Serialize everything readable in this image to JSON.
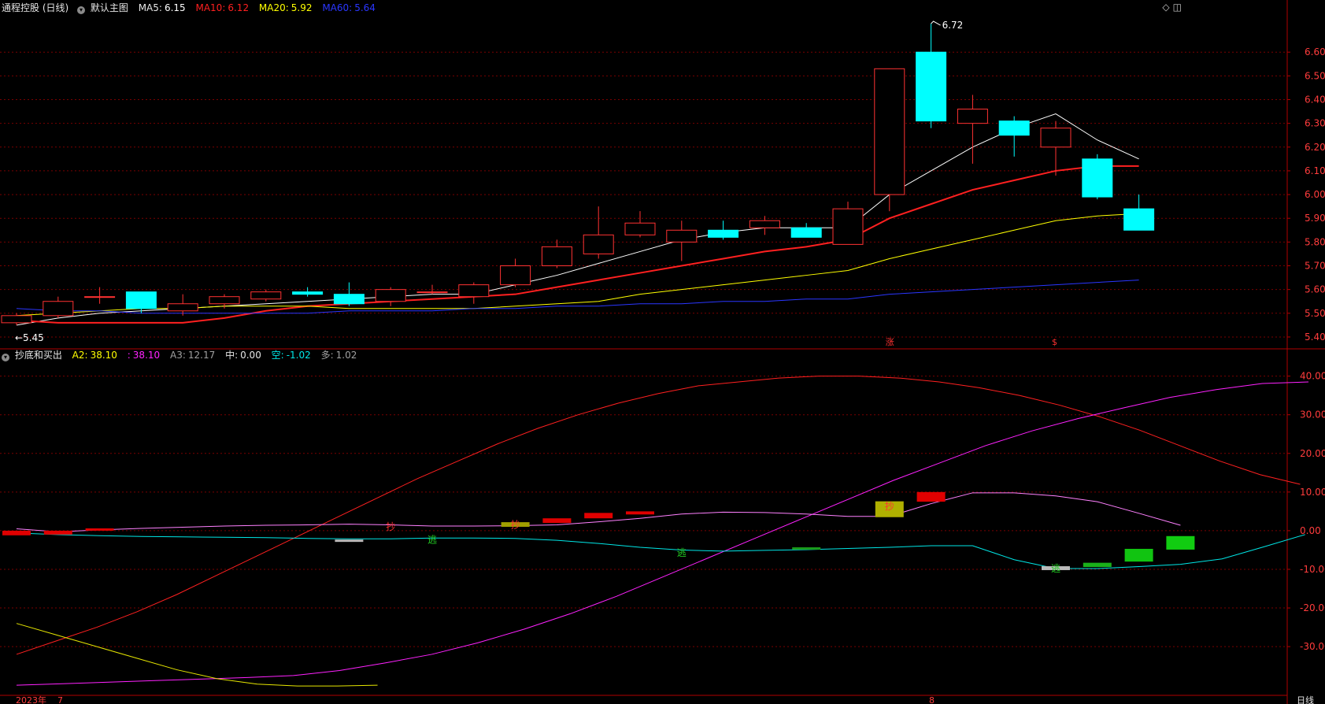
{
  "header": {
    "title": "通程控股 (日线)",
    "template_label": "默认主图",
    "ma5_label": "MA5:",
    "ma5_value": "6.15",
    "ma5_color": "#ffffff",
    "ma10_label": "MA10:",
    "ma10_value": "6.12",
    "ma10_color": "#ff2020",
    "ma20_label": "MA20:",
    "ma20_value": "5.92",
    "ma20_color": "#ffff00",
    "ma60_label": "MA60:",
    "ma60_value": "5.64",
    "ma60_color": "#2a36ff"
  },
  "indicator_header": {
    "name": "抄底和买出",
    "a2_label": "A2:",
    "a2_value": "38.10",
    "a2b_label": ":",
    "a2b_value": "38.10",
    "a3_label": "A3:",
    "a3_value": "12.17",
    "zhong_label": "中:",
    "zhong_value": "0.00",
    "kong_label": "空:",
    "kong_value": "-1.02",
    "duo_label": "多:",
    "duo_value": "1.02"
  },
  "colors": {
    "up": "#ff3232",
    "down": "#00ffff",
    "axis": "#b00000",
    "grid": "#7a0000",
    "axis_label": "#ff3c3c"
  },
  "chart_data": [
    {
      "type": "candlestick",
      "name": "price",
      "ylim": [
        5.36,
        6.74
      ],
      "y_ticks": [
        "5.40",
        "5.50",
        "5.60",
        "5.70",
        "5.80",
        "5.90",
        "6.00",
        "6.10",
        "6.20",
        "6.30",
        "6.40",
        "6.50",
        "6.60"
      ],
      "candles": [
        {
          "o": 5.46,
          "h": 5.5,
          "l": 5.45,
          "c": 5.49
        },
        {
          "o": 5.49,
          "h": 5.57,
          "l": 5.48,
          "c": 5.55
        },
        {
          "o": 5.57,
          "h": 5.61,
          "l": 5.54,
          "c": 5.57
        },
        {
          "o": 5.59,
          "h": 5.59,
          "l": 5.5,
          "c": 5.52
        },
        {
          "o": 5.51,
          "h": 5.58,
          "l": 5.49,
          "c": 5.54
        },
        {
          "o": 5.54,
          "h": 5.58,
          "l": 5.52,
          "c": 5.57
        },
        {
          "o": 5.56,
          "h": 5.6,
          "l": 5.55,
          "c": 5.59
        },
        {
          "o": 5.59,
          "h": 5.61,
          "l": 5.57,
          "c": 5.58
        },
        {
          "o": 5.58,
          "h": 5.63,
          "l": 5.53,
          "c": 5.54
        },
        {
          "o": 5.55,
          "h": 5.61,
          "l": 5.53,
          "c": 5.6
        },
        {
          "o": 5.59,
          "h": 5.62,
          "l": 5.58,
          "c": 5.59
        },
        {
          "o": 5.57,
          "h": 5.63,
          "l": 5.54,
          "c": 5.62
        },
        {
          "o": 5.62,
          "h": 5.73,
          "l": 5.61,
          "c": 5.7
        },
        {
          "o": 5.7,
          "h": 5.81,
          "l": 5.69,
          "c": 5.78
        },
        {
          "o": 5.75,
          "h": 5.95,
          "l": 5.73,
          "c": 5.83
        },
        {
          "o": 5.83,
          "h": 5.93,
          "l": 5.82,
          "c": 5.88
        },
        {
          "o": 5.8,
          "h": 5.89,
          "l": 5.72,
          "c": 5.85
        },
        {
          "o": 5.85,
          "h": 5.89,
          "l": 5.81,
          "c": 5.82
        },
        {
          "o": 5.86,
          "h": 5.91,
          "l": 5.83,
          "c": 5.89
        },
        {
          "o": 5.86,
          "h": 5.88,
          "l": 5.82,
          "c": 5.82
        },
        {
          "o": 5.79,
          "h": 5.97,
          "l": 5.79,
          "c": 5.94
        },
        {
          "o": 6.0,
          "h": 6.53,
          "l": 5.93,
          "c": 6.53
        },
        {
          "o": 6.6,
          "h": 6.72,
          "l": 6.28,
          "c": 6.31
        },
        {
          "o": 6.3,
          "h": 6.42,
          "l": 6.13,
          "c": 6.36
        },
        {
          "o": 6.31,
          "h": 6.33,
          "l": 6.16,
          "c": 6.25
        },
        {
          "o": 6.2,
          "h": 6.31,
          "l": 6.08,
          "c": 6.28
        },
        {
          "o": 6.15,
          "h": 6.17,
          "l": 5.98,
          "c": 5.99
        },
        {
          "o": 5.94,
          "h": 6.0,
          "l": 5.85,
          "c": 5.85
        }
      ],
      "series": [
        {
          "name": "MA5",
          "color": "#ffffff",
          "values": [
            5.45,
            5.48,
            5.5,
            5.51,
            5.52,
            5.53,
            5.54,
            5.55,
            5.56,
            5.57,
            5.58,
            5.58,
            5.62,
            5.66,
            5.71,
            5.76,
            5.81,
            5.84,
            5.86,
            5.86,
            5.86,
            6.0,
            6.1,
            6.2,
            6.28,
            6.34,
            6.23,
            6.15
          ]
        },
        {
          "name": "MA10",
          "color": "#ff2020",
          "values": [
            5.47,
            5.46,
            5.46,
            5.46,
            5.46,
            5.48,
            5.51,
            5.53,
            5.54,
            5.55,
            5.56,
            5.57,
            5.58,
            5.61,
            5.64,
            5.67,
            5.7,
            5.73,
            5.76,
            5.78,
            5.81,
            5.9,
            5.96,
            6.02,
            6.06,
            6.1,
            6.12,
            6.12
          ]
        },
        {
          "name": "MA20",
          "color": "#ffff00",
          "values": [
            5.49,
            5.5,
            5.51,
            5.52,
            5.52,
            5.53,
            5.53,
            5.53,
            5.52,
            5.52,
            5.52,
            5.52,
            5.53,
            5.54,
            5.55,
            5.58,
            5.6,
            5.62,
            5.64,
            5.66,
            5.68,
            5.73,
            5.77,
            5.81,
            5.85,
            5.89,
            5.91,
            5.92
          ]
        },
        {
          "name": "MA60",
          "color": "#2a36ff",
          "values": [
            5.52,
            5.51,
            5.51,
            5.5,
            5.5,
            5.5,
            5.5,
            5.5,
            5.51,
            5.51,
            5.51,
            5.52,
            5.52,
            5.53,
            5.53,
            5.54,
            5.54,
            5.55,
            5.55,
            5.56,
            5.56,
            5.58,
            5.59,
            5.6,
            5.61,
            5.62,
            5.63,
            5.64
          ]
        }
      ],
      "annotations": {
        "high_label": "6.72",
        "low_label": "5.45"
      },
      "markers": [
        {
          "text": "涨",
          "index": 21
        },
        {
          "text": "$",
          "index": 25
        }
      ]
    },
    {
      "type": "line",
      "name": "抄底和买出",
      "ylim": [
        -42,
        44
      ],
      "y_ticks": [
        "40.00",
        "30.00",
        "20.00",
        "10.00",
        "0.00",
        "-10.00",
        "-20.00",
        "-30.00"
      ],
      "y_tick_values": [
        40,
        30,
        20,
        10,
        0,
        -10,
        -20,
        -30
      ],
      "series": [
        {
          "name": "A2",
          "color": "#ff2020",
          "values": [
            -32,
            -28.5,
            -25,
            -21,
            -16.5,
            -11.5,
            -6.5,
            -1.5,
            3.5,
            8.5,
            13.5,
            18,
            22.5,
            26.5,
            30,
            33,
            35.5,
            37.5,
            38.5,
            39.5,
            40,
            40,
            39.5,
            38.5,
            37,
            35,
            32.5,
            29.5,
            26,
            22,
            18,
            14.5,
            12
          ]
        },
        {
          "name": "A2b",
          "color": "#ff22ff",
          "values": [
            -40,
            -39.6,
            -39.2,
            -38.8,
            -38.4,
            -38,
            -37.5,
            -36.2,
            -34.2,
            -32,
            -29,
            -25.5,
            -21.5,
            -17,
            -12,
            -7,
            -2,
            3,
            8,
            13,
            17.5,
            22,
            25.8,
            29,
            31.8,
            34.5,
            36.5,
            38.1,
            38.5
          ]
        },
        {
          "name": "A3",
          "color": "#e6e600",
          "values": [
            -24,
            -27,
            -30,
            -33,
            -36,
            -38.3,
            -39.7,
            -40.2,
            -40.2,
            -40
          ]
        },
        {
          "name": "中",
          "color": "#ff80ff",
          "values": [
            0.5,
            -0.3,
            0.2,
            0.6,
            0.9,
            1.2,
            1.4,
            1.5,
            1.7,
            1.5,
            1.2,
            1.2,
            1.3,
            1.5,
            2.3,
            3.2,
            4.3,
            4.8,
            4.7,
            4.3,
            3.7,
            3.7,
            7,
            9.8,
            9.8,
            9,
            7.5,
            4.5,
            1.4
          ]
        },
        {
          "name": "空",
          "color": "#00e6e6",
          "values": [
            -0.6,
            -1.0,
            -1.3,
            -1.5,
            -1.6,
            -1.7,
            -1.8,
            -2.0,
            -2.1,
            -2.1,
            -1.9,
            -1.9,
            -2.0,
            -2.5,
            -3.3,
            -4.3,
            -5.0,
            -5.3,
            -5.1,
            -4.9,
            -4.6,
            -4.3,
            -3.9,
            -3.9,
            -7.5,
            -9.8,
            -9.8,
            -9.3,
            -8.7,
            -7.3,
            -4.2,
            -1.0
          ]
        }
      ],
      "bars": [
        {
          "index": 0,
          "from": 0,
          "to": -1.2,
          "color": "#e00000"
        },
        {
          "index": 1,
          "from": 0,
          "to": -1.0,
          "color": "#e00000"
        },
        {
          "index": 2,
          "from": 0,
          "to": 0.6,
          "color": "#e00000"
        },
        {
          "index": 8,
          "from": -2.3,
          "to": -2.9,
          "color": "#bbbbbb"
        },
        {
          "index": 12,
          "from": 1.0,
          "to": 2.2,
          "color": "#a0a000"
        },
        {
          "index": 13,
          "from": 2.0,
          "to": 3.2,
          "color": "#e00000"
        },
        {
          "index": 14,
          "from": 3.2,
          "to": 4.6,
          "color": "#e00000"
        },
        {
          "index": 15,
          "from": 4.2,
          "to": 5.0,
          "color": "#e00000"
        },
        {
          "index": 19,
          "from": -4.3,
          "to": -4.9,
          "color": "#1a9a1a"
        },
        {
          "index": 21,
          "from": 3.5,
          "to": 7.6,
          "color": "#b0b000"
        },
        {
          "index": 22,
          "from": 7.5,
          "to": 10.0,
          "color": "#e00000"
        },
        {
          "index": 25,
          "from": -9.2,
          "to": -10.2,
          "color": "#bbbbbb"
        },
        {
          "index": 26,
          "from": -8.3,
          "to": -9.4,
          "color": "#1ab01a"
        },
        {
          "index": 27,
          "from": -4.7,
          "to": -8.0,
          "color": "#11c411"
        },
        {
          "index": 28,
          "from": -1.4,
          "to": -4.9,
          "color": "#11cc11"
        }
      ],
      "signals": [
        {
          "text": "抄",
          "index": 9,
          "y": 1.2,
          "color": "#ff3232"
        },
        {
          "text": "逃",
          "index": 10,
          "y": -2.2,
          "color": "#22cc22"
        },
        {
          "text": "抄",
          "index": 12,
          "y": 1.7,
          "color": "#ff3232"
        },
        {
          "text": "逃",
          "index": 16,
          "y": -5.5,
          "color": "#22cc22"
        },
        {
          "text": "抄",
          "index": 21,
          "y": 6.5,
          "color": "#ff3232"
        },
        {
          "text": "逃",
          "index": 25,
          "y": -9.6,
          "color": "#22cc22"
        }
      ]
    }
  ],
  "footer": {
    "date_year": "2023年",
    "date_month1": "7",
    "date_month2": "8",
    "period_label": "日线"
  },
  "top_icons": [
    "diamond-icon",
    "window-icon"
  ]
}
